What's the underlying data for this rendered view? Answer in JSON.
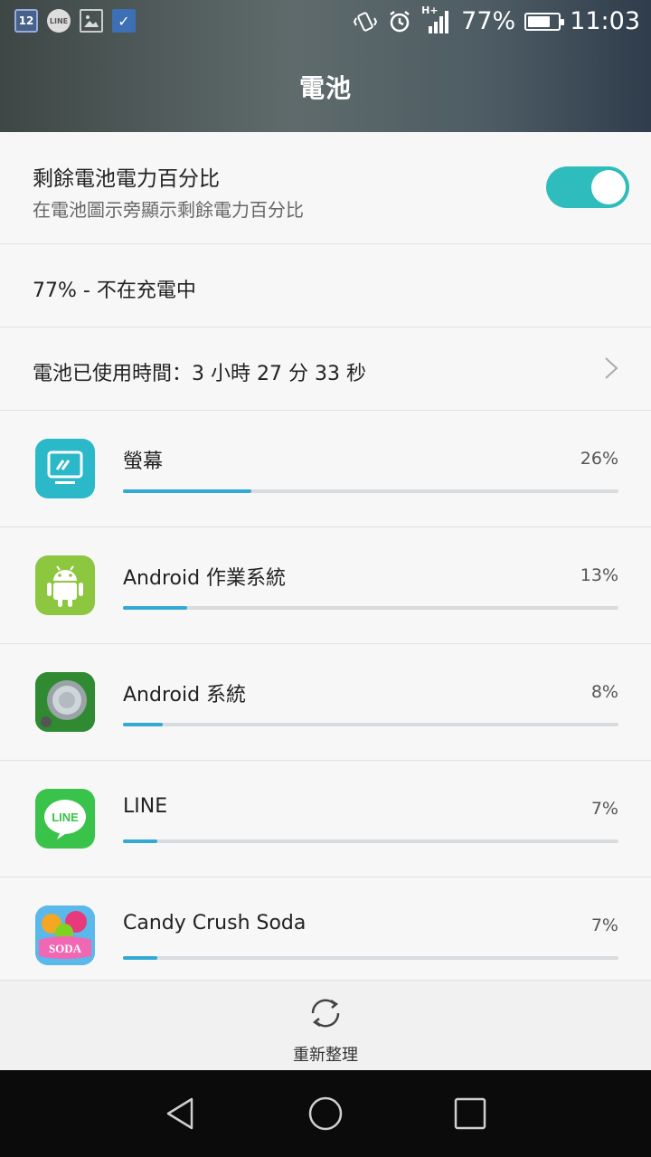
{
  "status_bar": {
    "calendar_day": "12",
    "line_badge": "LINE",
    "signal_type": "H+",
    "battery_text": "77%",
    "battery_level": 0.77,
    "time": "11:03",
    "icons": [
      "calendar-icon",
      "line-icon",
      "gallery-icon",
      "task-check-icon",
      "vibrate-icon",
      "alarm-icon",
      "signal-icon",
      "battery-icon"
    ]
  },
  "header": {
    "title": "電池"
  },
  "percent_setting": {
    "title": "剩餘電池電力百分比",
    "subtitle": "在電池圖示旁顯示剩餘電力百分比",
    "enabled": true
  },
  "battery_status": {
    "text": "77% - 不在充電中"
  },
  "usage_time": {
    "text": "電池已使用時間：3 小時 27 分 33 秒"
  },
  "apps": [
    {
      "name": "螢幕",
      "percent_label": "26%",
      "fraction": 0.26,
      "icon": "screen-icon"
    },
    {
      "name": "Android 作業系統",
      "percent_label": "13%",
      "fraction": 0.13,
      "icon": "android-os-icon"
    },
    {
      "name": "Android 系統",
      "percent_label": "8%",
      "fraction": 0.08,
      "icon": "android-system-icon"
    },
    {
      "name": "LINE",
      "percent_label": "7%",
      "fraction": 0.07,
      "icon": "line-app-icon",
      "icon_text": "LINE"
    },
    {
      "name": "Candy Crush Soda",
      "percent_label": "7%",
      "fraction": 0.07,
      "icon": "candy-crush-icon",
      "icon_text": "SODA"
    }
  ],
  "action_bar": {
    "refresh_label": "重新整理"
  },
  "colors": {
    "accent": "#2ebcbc",
    "bar": "#33a9d6",
    "line_green": "#3ac34a",
    "android_green": "#8dc63f"
  }
}
